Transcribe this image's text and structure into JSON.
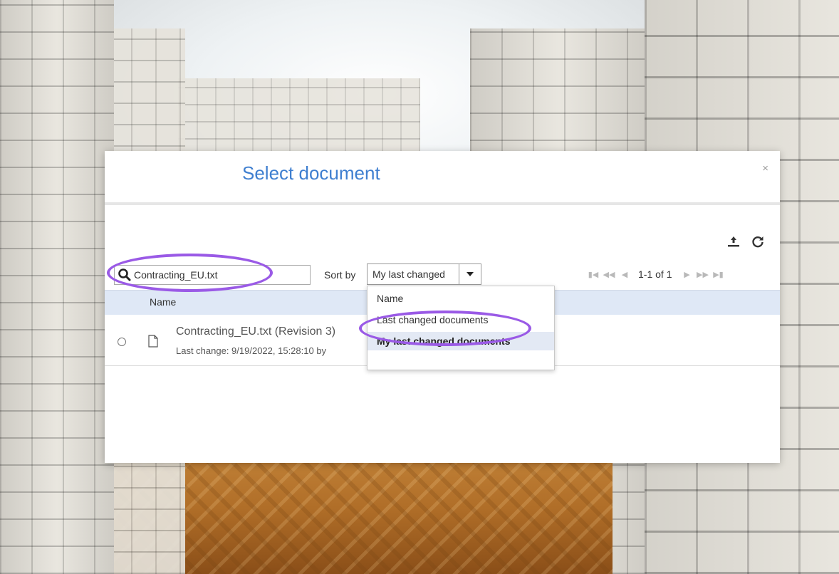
{
  "modal": {
    "title": "Select document",
    "close_label": "×"
  },
  "icons": {
    "upload": "upload-icon",
    "refresh": "refresh-icon",
    "search": "search-icon",
    "file": "file-icon",
    "caret": "caret-down-icon"
  },
  "toolbar": {
    "search_value": "Contracting_EU.txt",
    "sort_label": "Sort by",
    "sort_selected": "My last changed",
    "pagination": "1-1 of 1"
  },
  "grid": {
    "header_name": "Name",
    "rows": [
      {
        "title": "Contracting_EU.txt (Revision 3)",
        "meta": "Last change: 9/19/2022, 15:28:10 by"
      }
    ]
  },
  "dropdown": {
    "options": [
      "Name",
      "Last changed documents",
      "My last changed documents"
    ],
    "selected_index": 2
  },
  "colors": {
    "title": "#3f7fd0",
    "header_bg": "#dfe8f6",
    "annotation": "#9a5ae6"
  }
}
